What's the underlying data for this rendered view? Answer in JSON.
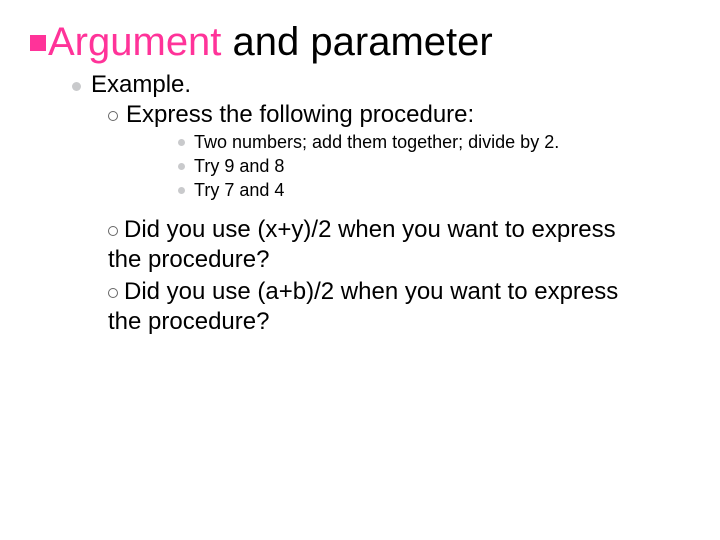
{
  "title": {
    "word1": "Argument",
    "rest": " and parameter"
  },
  "l1": {
    "text": "Example."
  },
  "l2a": {
    "text": "Express the following procedure:"
  },
  "l3": {
    "a": "Two numbers; add them together; divide by 2.",
    "b": "Try 9 and 8",
    "c": "Try 7 and 4"
  },
  "q1": {
    "line1": "Did you use (x+y)/2 when you want to express",
    "line2": "the procedure?"
  },
  "q2": {
    "line1": "Did you use (a+b)/2 when you want to express",
    "line2": "the procedure?"
  }
}
